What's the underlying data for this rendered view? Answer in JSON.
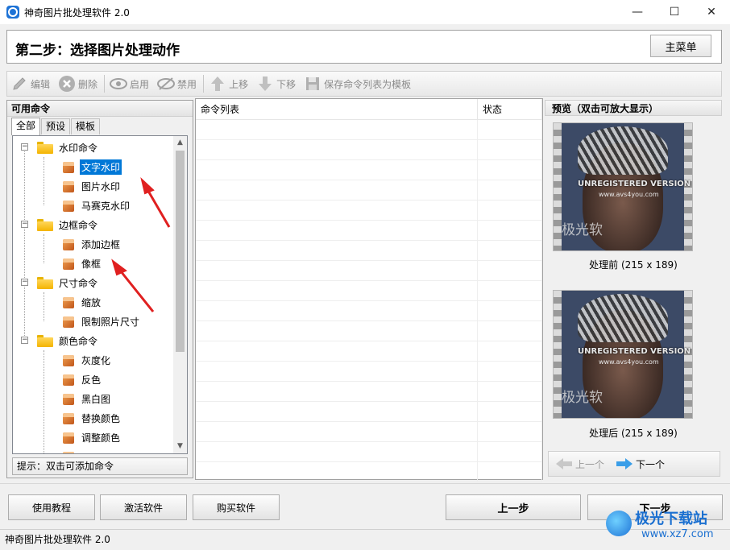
{
  "window": {
    "title": "神奇图片批处理软件 2.0",
    "controls": [
      "—",
      "☐",
      "✕"
    ]
  },
  "step": {
    "title": "第二步：选择图片处理动作",
    "main_menu": "主菜单"
  },
  "toolbar": {
    "edit": "编辑",
    "delete": "删除",
    "enable": "启用",
    "disable": "禁用",
    "move_up": "上移",
    "move_down": "下移",
    "save_template": "保存命令列表为模板"
  },
  "left": {
    "header": "可用命令",
    "tabs": [
      "全部",
      "预设",
      "模板"
    ],
    "tree": [
      {
        "label": "水印命令",
        "children": [
          "文字水印",
          "图片水印",
          "马赛克水印"
        ]
      },
      {
        "label": "边框命令",
        "children": [
          "添加边框",
          "像框"
        ]
      },
      {
        "label": "尺寸命令",
        "children": [
          "缩放",
          "限制照片尺寸"
        ]
      },
      {
        "label": "颜色命令",
        "children": [
          "灰度化",
          "反色",
          "黑白图",
          "替换颜色",
          "调整颜色"
        ]
      }
    ],
    "selected": "文字水印",
    "hint": "提示：双击可添加命令"
  },
  "middle": {
    "col_commands": "命令列表",
    "col_status": "状态"
  },
  "right": {
    "header": "预览（双击可放大显示）",
    "before_caption": "处理前 (215 x 189)",
    "after_caption": "处理后 (215 x 189)",
    "watermark_line1": "UNREGISTERED VERSION",
    "watermark_line2": "www.avs4you.com",
    "watermark_line3": "极光软",
    "prev": "上一个",
    "next": "下一个"
  },
  "bottom": {
    "tutorial": "使用教程",
    "activate": "激活软件",
    "buy": "购买软件",
    "prev_step": "上一步",
    "next_step": "下一步"
  },
  "status": {
    "text": "神奇图片批处理软件 2.0"
  },
  "site_watermark": {
    "name": "极光下载站",
    "url": "www.xz7.com"
  },
  "colors": {
    "selection": "#0078d7",
    "annotation_arrow": "#e02020",
    "accent": "#1e73d6"
  }
}
